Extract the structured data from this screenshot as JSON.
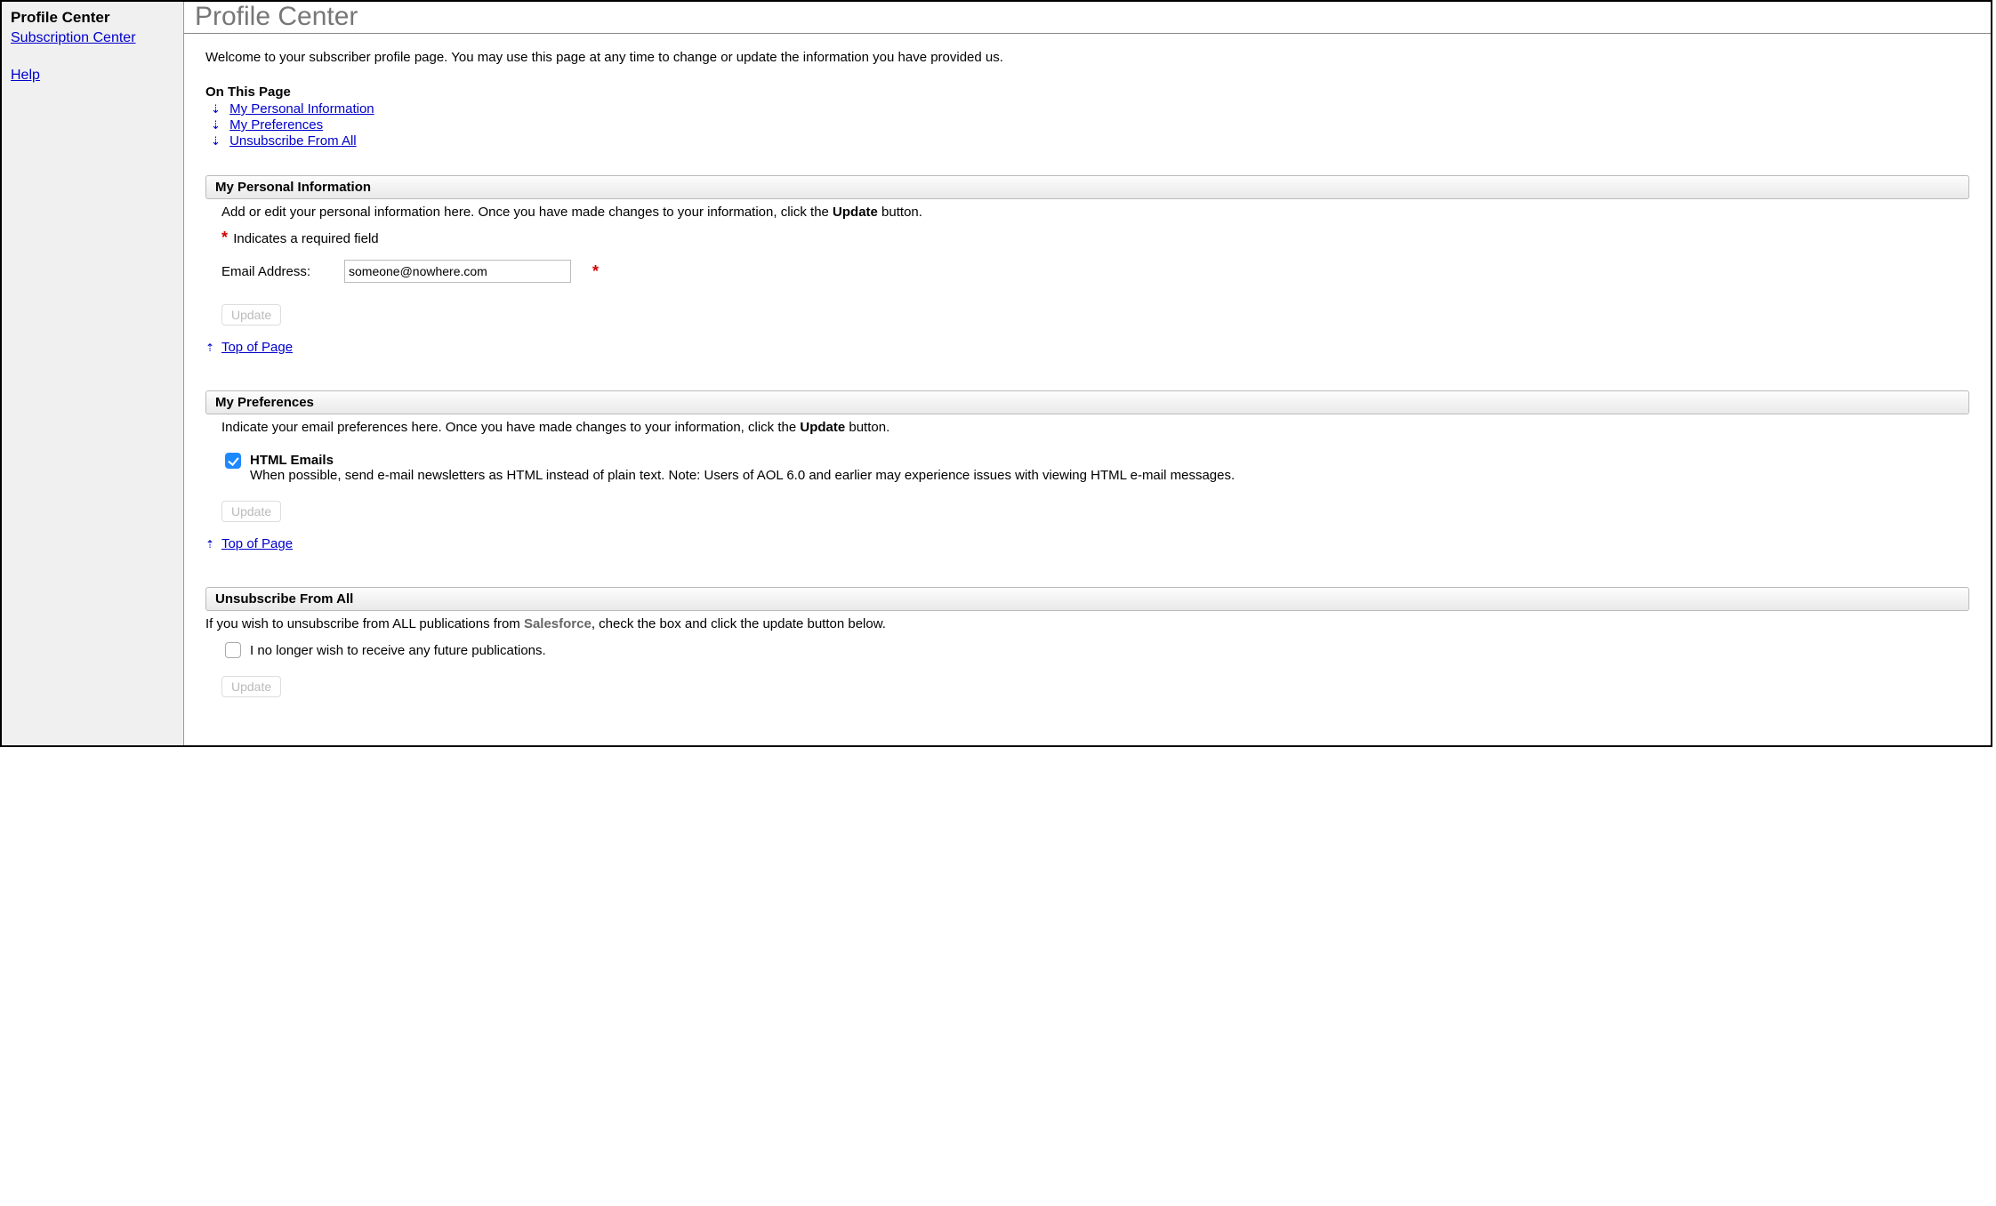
{
  "sidebar": {
    "title": "Profile Center",
    "links": {
      "subscription": "Subscription Center",
      "help": "Help"
    }
  },
  "header": {
    "page_title": "Profile Center"
  },
  "intro": {
    "welcome": "Welcome to your subscriber profile page. You may use this page at any time to change or update the information you have provided us.",
    "on_this_page_label": "On This Page",
    "toc": {
      "personal_info": "My Personal Information",
      "preferences": "My Preferences",
      "unsubscribe": "Unsubscribe From All"
    }
  },
  "personal_info": {
    "section_title": "My Personal Information",
    "desc_before": "Add or edit your personal information here. Once you have made changes to your information, click the ",
    "desc_bold": "Update",
    "desc_after": " button.",
    "required_note": "Indicates a required field",
    "email_label": "Email Address:",
    "email_value": "someone@nowhere.com",
    "update_label": "Update",
    "top_link": "Top of Page"
  },
  "preferences": {
    "section_title": "My Preferences",
    "desc_before": "Indicate your email preferences here. Once you have made changes to your information, click the ",
    "desc_bold": "Update",
    "desc_after": " button.",
    "html_emails": {
      "checked": true,
      "title": "HTML Emails",
      "subtitle": "When possible, send e-mail newsletters as HTML instead of plain text. Note: Users of AOL 6.0 and earlier may experience issues with viewing HTML e-mail messages."
    },
    "update_label": "Update",
    "top_link": "Top of Page"
  },
  "unsubscribe": {
    "section_title": "Unsubscribe From All",
    "desc_before": "If you wish to unsubscribe from ALL publications from ",
    "desc_brand": "Salesforce",
    "desc_after": ", check the box and click the update button below.",
    "checkbox_checked": false,
    "checkbox_label": "I no longer wish to receive any future publications.",
    "update_label": "Update"
  }
}
